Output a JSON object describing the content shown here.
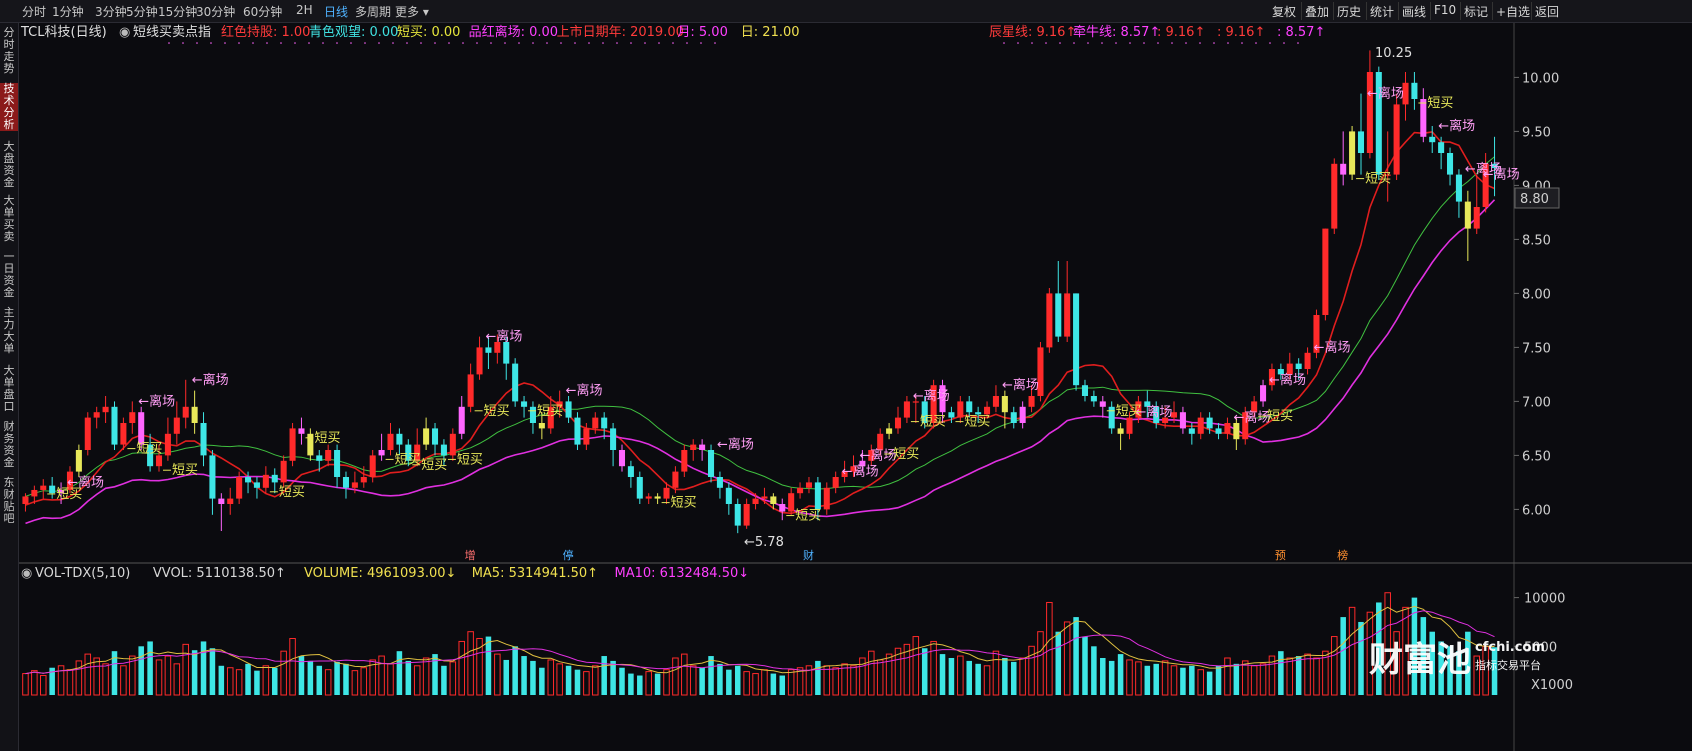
{
  "toolbar": {
    "periods": [
      "分时",
      "1分钟",
      "3分钟",
      "5分钟",
      "15分钟",
      "30分钟",
      "60分钟",
      "2H",
      "日线",
      "多周期",
      "更多"
    ],
    "active_period": "日线",
    "right_buttons": [
      "复权",
      "叠加",
      "历史",
      "统计",
      "画线",
      "F10",
      "标记",
      "+自选",
      "返回"
    ]
  },
  "sidebar": {
    "tabs": [
      "分时走势",
      "技术分析",
      "大盘资金",
      "大单买卖",
      "一日资金",
      "主力大单",
      "大单盘口",
      "财务资金",
      "东财贴吧"
    ],
    "active_tab": "技术分析"
  },
  "main_panel": {
    "title": "TCL科技(日线)",
    "indicator_name": "短线买卖点指",
    "legend": [
      {
        "text": "红色持股: 1.00",
        "color": "#ff3b3b"
      },
      {
        "text": "青色观望: 0.00",
        "color": "#40e0e0"
      },
      {
        "text": "短买: 0.00",
        "color": "#e6e63c"
      },
      {
        "text": "品红离场: 0.00",
        "color": "#ff40ff"
      },
      {
        "text": "上市日期年: 2019.00",
        "color": "#ff3b3b"
      },
      {
        "text": "月: 5.00",
        "color": "#ff40ff"
      },
      {
        "text": "日: 21.00",
        "color": "#f0e050"
      }
    ],
    "legend_right": [
      {
        "text": "辰星线: 9.16↑",
        "color": "#ff3b3b"
      },
      {
        "text": "牵牛线: 8.57↑",
        "color": "#ff40ff"
      },
      {
        "text": ": 9.16↑",
        "color": "#ff3b3b"
      },
      {
        "text": ": 9.16↑",
        "color": "#ff3b3b"
      },
      {
        "text": ": 8.57↑",
        "color": "#ff40ff"
      }
    ],
    "price_ticks": [
      "10.00",
      "9.50",
      "9.00",
      "8.50",
      "8.00",
      "7.50",
      "7.00",
      "6.50",
      "6.00"
    ],
    "current_price_label": "8.80",
    "high_label": "10.25",
    "low_label": "←5.78",
    "signal_sell": "←离场",
    "signal_buy": "短买",
    "event_markers": [
      "增",
      "停",
      "财",
      "预",
      "榜"
    ]
  },
  "volume_panel": {
    "legend": [
      {
        "text": "VOL-TDX(5,10)",
        "color": "#d8d8d8"
      },
      {
        "text": "VVOL: 5110138.50↑",
        "color": "#d8d8d8"
      },
      {
        "text": "VOLUME: 4961093.00↓",
        "color": "#f0e050"
      },
      {
        "text": "MA5: 5314941.50↑",
        "color": "#f0e050"
      },
      {
        "text": "MA10: 6132484.50↓",
        "color": "#ff40ff"
      }
    ],
    "ticks": [
      "10000",
      "5000"
    ],
    "unit_label": "X1000"
  },
  "watermark": {
    "brand": "财富池",
    "url": "cfchi.com",
    "sub": "指标交易平台"
  },
  "colors": {
    "up": "#ff2a2a",
    "down": "#3ee6e6",
    "magenta": "#ff66ff",
    "yellow_bar": "#e8e85a",
    "ma_short": "#e01e1e",
    "ma_long": "#e030e0",
    "ma_green": "#40c040"
  },
  "chart_data": {
    "type": "candlestick",
    "title": "TCL科技(日线)",
    "ylim": [
      5.55,
      10.3
    ],
    "candles": [
      [
        6.05,
        6.12,
        5.98,
        6.15
      ],
      [
        6.12,
        6.18,
        6.05,
        6.22
      ],
      [
        6.18,
        6.22,
        6.1,
        6.28
      ],
      [
        6.22,
        6.15,
        6.1,
        6.3
      ],
      [
        6.15,
        6.18,
        6.05,
        6.25
      ],
      [
        6.18,
        6.35,
        6.15,
        6.4
      ],
      [
        6.35,
        6.55,
        6.3,
        6.6
      ],
      [
        6.55,
        6.85,
        6.5,
        6.9
      ],
      [
        6.85,
        6.9,
        6.75,
        6.95
      ],
      [
        6.9,
        6.95,
        6.8,
        7.05
      ],
      [
        6.95,
        6.6,
        6.55,
        7.0
      ],
      [
        6.6,
        6.8,
        6.55,
        6.85
      ],
      [
        6.8,
        6.9,
        6.7,
        7.0
      ],
      [
        6.9,
        6.6,
        6.55,
        6.95
      ],
      [
        6.6,
        6.4,
        6.35,
        6.7
      ],
      [
        6.4,
        6.5,
        6.35,
        6.6
      ],
      [
        6.5,
        6.7,
        6.45,
        6.85
      ],
      [
        6.7,
        6.85,
        6.6,
        7.0
      ],
      [
        6.85,
        6.95,
        6.75,
        7.2
      ],
      [
        6.95,
        6.8,
        6.7,
        7.1
      ],
      [
        6.8,
        6.5,
        6.4,
        6.9
      ],
      [
        6.5,
        6.1,
        5.95,
        6.55
      ],
      [
        6.1,
        6.05,
        5.8,
        6.15
      ],
      [
        6.05,
        6.1,
        5.95,
        6.2
      ],
      [
        6.1,
        6.3,
        6.05,
        6.35
      ],
      [
        6.3,
        6.25,
        6.15,
        6.35
      ],
      [
        6.25,
        6.2,
        6.1,
        6.3
      ],
      [
        6.2,
        6.32,
        6.15,
        6.4
      ],
      [
        6.32,
        6.25,
        6.15,
        6.38
      ],
      [
        6.25,
        6.45,
        6.2,
        6.5
      ],
      [
        6.45,
        6.75,
        6.4,
        6.8
      ],
      [
        6.75,
        6.7,
        6.6,
        6.85
      ],
      [
        6.7,
        6.5,
        6.45,
        6.75
      ],
      [
        6.5,
        6.45,
        6.35,
        6.55
      ],
      [
        6.45,
        6.55,
        6.4,
        6.6
      ],
      [
        6.55,
        6.3,
        6.2,
        6.6
      ],
      [
        6.3,
        6.2,
        6.1,
        6.35
      ],
      [
        6.2,
        6.25,
        6.15,
        6.35
      ],
      [
        6.25,
        6.3,
        6.2,
        6.4
      ],
      [
        6.3,
        6.5,
        6.25,
        6.55
      ],
      [
        6.5,
        6.55,
        6.45,
        6.7
      ],
      [
        6.55,
        6.7,
        6.5,
        6.8
      ],
      [
        6.7,
        6.6,
        6.5,
        6.75
      ],
      [
        6.6,
        6.45,
        6.4,
        6.65
      ],
      [
        6.45,
        6.6,
        6.4,
        6.75
      ],
      [
        6.6,
        6.75,
        6.55,
        6.85
      ],
      [
        6.75,
        6.6,
        6.5,
        6.8
      ],
      [
        6.6,
        6.5,
        6.4,
        6.65
      ],
      [
        6.5,
        6.7,
        6.45,
        6.75
      ],
      [
        6.7,
        6.95,
        6.65,
        7.05
      ],
      [
        6.95,
        7.25,
        6.9,
        7.35
      ],
      [
        7.25,
        7.5,
        7.2,
        7.6
      ],
      [
        7.5,
        7.45,
        7.3,
        7.6
      ],
      [
        7.45,
        7.55,
        7.35,
        7.62
      ],
      [
        7.55,
        7.35,
        7.2,
        7.6
      ],
      [
        7.35,
        7.0,
        6.95,
        7.4
      ],
      [
        7.0,
        6.95,
        6.85,
        7.05
      ],
      [
        6.95,
        6.8,
        6.7,
        7.0
      ],
      [
        6.8,
        6.75,
        6.65,
        6.9
      ],
      [
        6.75,
        6.95,
        6.7,
        7.05
      ],
      [
        6.95,
        7.0,
        6.85,
        7.1
      ],
      [
        7.0,
        6.85,
        6.8,
        7.05
      ],
      [
        6.85,
        6.6,
        6.55,
        6.9
      ],
      [
        6.6,
        6.75,
        6.55,
        6.8
      ],
      [
        6.75,
        6.85,
        6.7,
        6.9
      ],
      [
        6.85,
        6.75,
        6.65,
        6.9
      ],
      [
        6.75,
        6.55,
        6.4,
        6.8
      ],
      [
        6.55,
        6.4,
        6.35,
        6.6
      ],
      [
        6.4,
        6.3,
        6.2,
        6.45
      ],
      [
        6.3,
        6.1,
        6.05,
        6.35
      ],
      [
        6.1,
        6.12,
        6.05,
        6.15
      ],
      [
        6.12,
        6.1,
        6.05,
        6.15
      ],
      [
        6.1,
        6.2,
        6.05,
        6.25
      ],
      [
        6.2,
        6.35,
        6.15,
        6.4
      ],
      [
        6.35,
        6.55,
        6.3,
        6.6
      ],
      [
        6.55,
        6.6,
        6.45,
        6.65
      ],
      [
        6.6,
        6.55,
        6.45,
        6.65
      ],
      [
        6.55,
        6.3,
        6.25,
        6.6
      ],
      [
        6.3,
        6.2,
        6.1,
        6.35
      ],
      [
        6.2,
        6.05,
        5.95,
        6.25
      ],
      [
        6.05,
        5.85,
        5.78,
        6.1
      ],
      [
        5.85,
        6.05,
        5.82,
        6.1
      ],
      [
        6.05,
        6.1,
        6.0,
        6.15
      ],
      [
        6.1,
        6.12,
        6.05,
        6.2
      ],
      [
        6.12,
        6.05,
        6.0,
        6.15
      ],
      [
        6.05,
        5.98,
        5.9,
        6.1
      ],
      [
        5.98,
        6.15,
        5.95,
        6.2
      ],
      [
        6.15,
        6.2,
        6.1,
        6.25
      ],
      [
        6.2,
        6.25,
        6.15,
        6.3
      ],
      [
        6.25,
        6.0,
        5.9,
        6.3
      ],
      [
        6.0,
        6.2,
        5.95,
        6.25
      ],
      [
        6.2,
        6.3,
        6.15,
        6.35
      ],
      [
        6.3,
        6.35,
        6.25,
        6.45
      ],
      [
        6.35,
        6.4,
        6.3,
        6.5
      ],
      [
        6.4,
        6.45,
        6.35,
        6.55
      ],
      [
        6.45,
        6.55,
        6.4,
        6.6
      ],
      [
        6.55,
        6.7,
        6.5,
        6.75
      ],
      [
        6.7,
        6.75,
        6.65,
        6.8
      ],
      [
        6.75,
        6.85,
        6.7,
        6.95
      ],
      [
        6.85,
        7.0,
        6.8,
        7.05
      ],
      [
        7.0,
        7.0,
        6.8,
        7.05
      ],
      [
        7.0,
        6.8,
        6.75,
        7.05
      ],
      [
        6.8,
        7.15,
        6.75,
        7.2
      ],
      [
        7.15,
        6.9,
        6.8,
        7.2
      ],
      [
        6.9,
        6.85,
        6.8,
        6.95
      ],
      [
        6.85,
        7.0,
        6.8,
        7.05
      ],
      [
        7.0,
        6.9,
        6.85,
        7.05
      ],
      [
        6.9,
        6.88,
        6.8,
        6.95
      ],
      [
        6.88,
        6.95,
        6.85,
        7.0
      ],
      [
        6.95,
        7.05,
        6.9,
        7.15
      ],
      [
        7.05,
        6.9,
        6.75,
        7.1
      ],
      [
        6.9,
        6.8,
        6.75,
        6.95
      ],
      [
        6.8,
        6.95,
        6.75,
        7.0
      ],
      [
        6.95,
        7.05,
        6.9,
        7.15
      ],
      [
        7.05,
        7.5,
        7.0,
        7.55
      ],
      [
        7.5,
        8.0,
        7.45,
        8.05
      ],
      [
        8.0,
        7.6,
        7.55,
        8.3
      ],
      [
        7.6,
        8.0,
        7.55,
        8.3
      ],
      [
        8.0,
        7.15,
        7.1,
        8.0
      ],
      [
        7.15,
        7.05,
        7.0,
        7.2
      ],
      [
        7.05,
        7.0,
        6.95,
        7.1
      ],
      [
        7.0,
        6.95,
        6.85,
        7.05
      ],
      [
        6.95,
        6.75,
        6.7,
        7.0
      ],
      [
        6.75,
        6.7,
        6.55,
        6.8
      ],
      [
        6.7,
        6.85,
        6.65,
        6.9
      ],
      [
        6.85,
        7.0,
        6.8,
        7.05
      ],
      [
        7.0,
        6.95,
        6.85,
        7.1
      ],
      [
        6.95,
        6.8,
        6.75,
        7.0
      ],
      [
        6.8,
        6.85,
        6.75,
        6.95
      ],
      [
        6.85,
        6.9,
        6.8,
        7.0
      ],
      [
        6.9,
        6.75,
        6.7,
        6.95
      ],
      [
        6.75,
        6.7,
        6.6,
        6.8
      ],
      [
        6.7,
        6.85,
        6.65,
        6.9
      ],
      [
        6.85,
        6.75,
        6.7,
        6.9
      ],
      [
        6.75,
        6.7,
        6.65,
        6.8
      ],
      [
        6.7,
        6.8,
        6.65,
        6.85
      ],
      [
        6.8,
        6.65,
        6.55,
        6.85
      ],
      [
        6.65,
        6.9,
        6.6,
        6.95
      ],
      [
        6.9,
        7.0,
        6.85,
        7.05
      ],
      [
        7.0,
        7.15,
        6.95,
        7.2
      ],
      [
        7.15,
        7.3,
        7.1,
        7.35
      ],
      [
        7.3,
        7.25,
        7.2,
        7.35
      ],
      [
        7.25,
        7.35,
        7.2,
        7.45
      ],
      [
        7.35,
        7.3,
        7.2,
        7.4
      ],
      [
        7.3,
        7.45,
        7.25,
        7.5
      ],
      [
        7.45,
        7.8,
        7.4,
        7.85
      ],
      [
        7.8,
        8.6,
        7.75,
        8.6
      ],
      [
        8.6,
        9.2,
        8.55,
        9.25
      ],
      [
        9.2,
        9.1,
        9.0,
        9.5
      ],
      [
        9.1,
        9.5,
        9.05,
        9.55
      ],
      [
        9.5,
        9.3,
        9.1,
        9.85
      ],
      [
        9.3,
        10.05,
        9.25,
        10.25
      ],
      [
        10.05,
        9.1,
        9.05,
        10.1
      ],
      [
        9.1,
        9.1,
        8.85,
        9.5
      ],
      [
        9.1,
        9.75,
        9.05,
        9.85
      ],
      [
        9.75,
        9.95,
        9.6,
        10.05
      ],
      [
        9.95,
        9.8,
        9.7,
        10.05
      ],
      [
        9.8,
        9.45,
        9.4,
        9.9
      ],
      [
        9.45,
        9.4,
        9.3,
        9.55
      ],
      [
        9.4,
        9.3,
        9.15,
        9.45
      ],
      [
        9.3,
        9.1,
        9.0,
        9.35
      ],
      [
        9.1,
        8.85,
        8.7,
        9.15
      ],
      [
        8.85,
        8.6,
        8.3,
        8.95
      ],
      [
        8.6,
        8.8,
        8.55,
        9.1
      ],
      [
        8.8,
        9.2,
        8.75,
        9.3
      ],
      [
        9.2,
        9.16,
        8.9,
        9.45
      ]
    ],
    "volume": [
      2.2,
      2.5,
      2.0,
      2.8,
      3.0,
      2.6,
      3.5,
      4.2,
      3.8,
      3.2,
      4.5,
      3.0,
      4.0,
      5.0,
      5.5,
      3.6,
      4.0,
      3.2,
      5.2,
      4.6,
      5.5,
      4.8,
      3.0,
      2.8,
      2.6,
      3.2,
      2.5,
      3.0,
      2.8,
      4.5,
      5.8,
      4.0,
      3.5,
      3.0,
      2.6,
      3.4,
      3.2,
      2.5,
      2.8,
      3.6,
      4.0,
      3.2,
      4.5,
      3.5,
      3.0,
      3.8,
      4.2,
      3.0,
      3.4,
      5.5,
      6.5,
      5.8,
      6.0,
      4.2,
      3.6,
      5.0,
      4.0,
      3.5,
      2.8,
      3.6,
      3.2,
      3.0,
      2.6,
      2.4,
      3.0,
      4.0,
      3.5,
      2.8,
      2.2,
      2.0,
      2.4,
      2.2,
      2.6,
      3.8,
      4.2,
      3.0,
      2.8,
      4.0,
      3.2,
      2.6,
      3.0,
      2.4,
      2.2,
      2.6,
      2.2,
      2.0,
      2.6,
      2.8,
      3.0,
      3.5,
      3.0,
      2.8,
      3.2,
      3.0,
      3.8,
      4.5,
      3.6,
      4.2,
      4.8,
      5.2,
      6.0,
      4.8,
      5.5,
      4.2,
      3.8,
      4.0,
      3.5,
      3.2,
      3.0,
      4.5,
      3.8,
      3.4,
      3.8,
      5.0,
      6.5,
      9.5,
      6.5,
      7.5,
      8.0,
      6.0,
      5.0,
      3.8,
      3.5,
      4.2,
      3.6,
      3.4,
      3.0,
      3.2,
      3.5,
      3.0,
      2.8,
      3.0,
      2.6,
      2.4,
      3.0,
      3.8,
      3.2,
      3.5,
      3.0,
      3.2,
      4.0,
      4.5,
      3.8,
      4.0,
      4.2,
      3.8,
      4.5,
      6.0,
      8.0,
      9.0,
      7.5,
      8.5,
      9.5,
      10.5,
      6.5,
      9.0,
      10.0,
      8.0,
      6.5,
      5.5,
      5.0,
      4.5,
      6.5,
      4.0,
      5.0,
      4.9
    ],
    "sell_signals": [
      4,
      12,
      18,
      51,
      60,
      77,
      91,
      93,
      99,
      109,
      124,
      135,
      139,
      144,
      150,
      158,
      161,
      163,
      166,
      173,
      178
    ],
    "buy_signals": [
      2,
      11,
      15,
      27,
      31,
      40,
      43,
      47,
      50,
      56,
      71,
      85,
      96,
      99,
      104,
      121,
      138,
      149,
      156,
      175
    ]
  }
}
